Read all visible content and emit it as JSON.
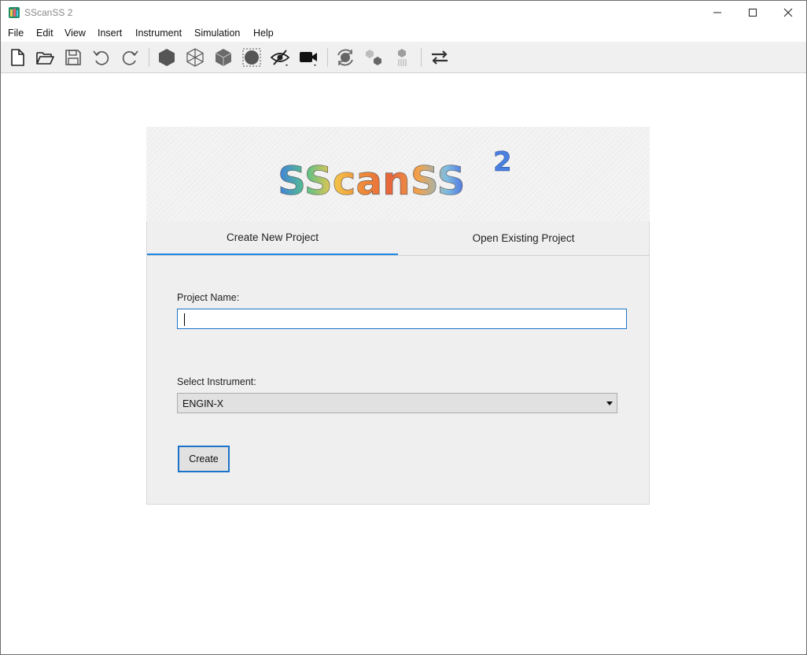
{
  "window": {
    "title": "SScanSS 2"
  },
  "menubar": {
    "items": [
      "File",
      "Edit",
      "View",
      "Insert",
      "Instrument",
      "Simulation",
      "Help"
    ]
  },
  "toolbar": {
    "icons": [
      "new-file-icon",
      "open-folder-icon",
      "save-icon",
      "undo-icon",
      "redo-icon",
      "solid-render-icon",
      "wireframe-render-icon",
      "transparent-render-icon",
      "boundary-icon",
      "visibility-icon",
      "camera-icon",
      "rotate-sample-icon",
      "align-points-icon",
      "vectors-icon",
      "swap-icon"
    ]
  },
  "welcome": {
    "logo_text": "SScanSS",
    "logo_superscript": "2",
    "tabs": [
      {
        "label": "Create New Project",
        "active": true
      },
      {
        "label": "Open Existing Project",
        "active": false
      }
    ],
    "project_name_label": "Project Name:",
    "project_name_value": "",
    "instrument_label": "Select Instrument:",
    "instrument_selected": "ENGIN-X",
    "create_label": "Create"
  },
  "colors": {
    "accent": "#1e88e5",
    "focus_border": "#1a73c9",
    "panel_bg": "#efefef",
    "toolbar_bg": "#f0f0f0"
  }
}
